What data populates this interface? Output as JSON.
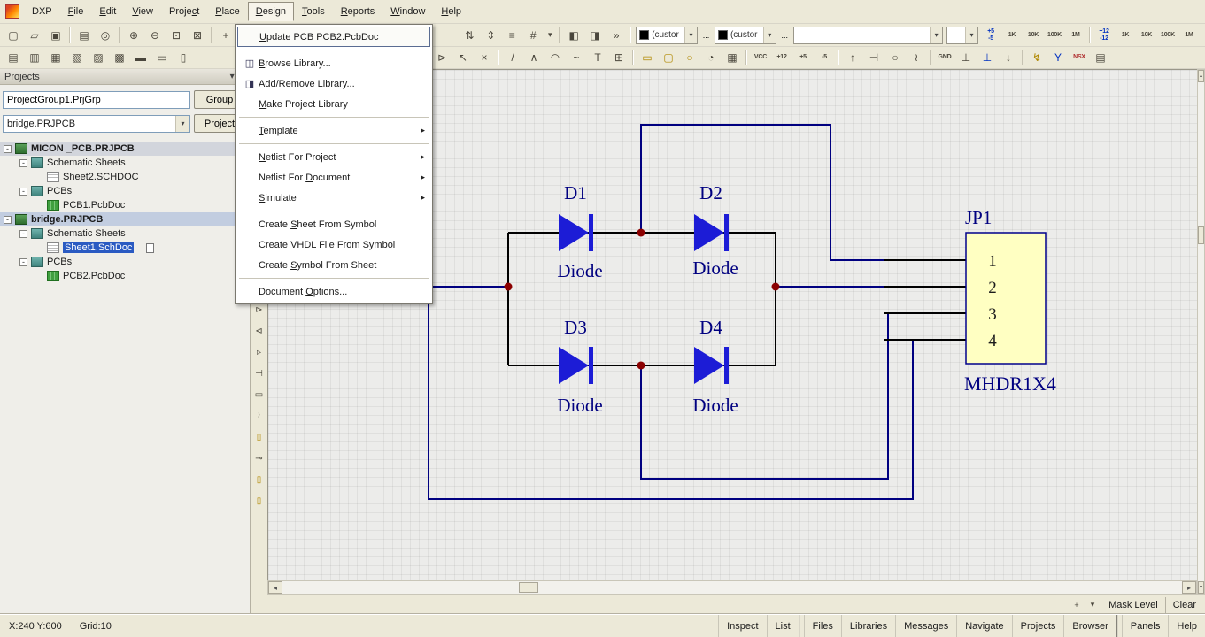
{
  "colors": {
    "chrome": "#ece9d8",
    "canvas-bg": "#ececea",
    "selection": "#2a5ac2",
    "wire": "#000080",
    "circuit": "#000000",
    "junction": "#8b0000",
    "diode": "#1c1cd6",
    "part-fill": "#ffffc2",
    "part-outline": "#00008b",
    "label": "#000080"
  },
  "menubar": {
    "items": [
      {
        "name": "menu-dxp",
        "label": "DXP",
        "hot": -1
      },
      {
        "name": "menu-file",
        "label": "File",
        "hot": 0
      },
      {
        "name": "menu-edit",
        "label": "Edit",
        "hot": 0
      },
      {
        "name": "menu-view",
        "label": "View",
        "hot": 0
      },
      {
        "name": "menu-project",
        "label": "Project",
        "hot": 5
      },
      {
        "name": "menu-place",
        "label": "Place",
        "hot": 0
      },
      {
        "name": "menu-design",
        "label": "Design",
        "hot": 0,
        "cls": "active"
      },
      {
        "name": "menu-tools",
        "label": "Tools",
        "hot": 0
      },
      {
        "name": "menu-reports",
        "label": "Reports",
        "hot": 0
      },
      {
        "name": "menu-window",
        "label": "Window",
        "hot": 0
      },
      {
        "name": "menu-help",
        "label": "Help",
        "hot": 0
      }
    ]
  },
  "design_menu": {
    "items": [
      {
        "name": "menu-update-pcb",
        "label": "Update PCB PCB2.PcbDoc",
        "hot": 0,
        "cls": "hover"
      },
      {
        "cls": "sep"
      },
      {
        "name": "menu-browse-library",
        "label": "Browse Library...",
        "hot": 0,
        "icon": "◫"
      },
      {
        "name": "menu-add-remove-library",
        "label": "Add/Remove Library...",
        "hot": 11,
        "icon": "◨"
      },
      {
        "name": "menu-make-project-library",
        "label": "Make Project Library",
        "hot": 0
      },
      {
        "cls": "sep"
      },
      {
        "name": "menu-template",
        "label": "Template",
        "hot": 0,
        "arrow": "▸"
      },
      {
        "cls": "sep"
      },
      {
        "name": "menu-netlist-project",
        "label": "Netlist For Project",
        "hot": 0,
        "arrow": "▸"
      },
      {
        "name": "menu-netlist-document",
        "label": "Netlist For Document",
        "hot": 12,
        "arrow": "▸"
      },
      {
        "name": "menu-simulate",
        "label": "Simulate",
        "hot": 0,
        "arrow": "▸"
      },
      {
        "cls": "sep"
      },
      {
        "name": "menu-create-sheet-from-symbol",
        "label": "Create Sheet From Symbol",
        "hot": 7
      },
      {
        "name": "menu-create-vhdl",
        "label": "Create VHDL File From Symbol",
        "hot": 7
      },
      {
        "name": "menu-create-symbol-from-sheet",
        "label": "Create Symbol From Sheet",
        "hot": 7
      },
      {
        "cls": "sep"
      },
      {
        "name": "menu-document-options",
        "label": "Document Options...",
        "hot": 9
      }
    ]
  },
  "toolbar1": {
    "left": [
      {
        "name": "new-document-button",
        "glyph": "▢"
      },
      {
        "name": "open-document-button",
        "glyph": "▱"
      },
      {
        "name": "save-button",
        "glyph": "▣"
      },
      {
        "cls": "sep"
      },
      {
        "name": "print-button",
        "glyph": "▤"
      },
      {
        "name": "print-preview-button",
        "glyph": "◎"
      },
      {
        "cls": "sep"
      },
      {
        "name": "zoom-in-button",
        "glyph": "⊕"
      },
      {
        "name": "zoom-out-button",
        "glyph": "⊖"
      },
      {
        "name": "zoom-area-button",
        "glyph": "⊡"
      },
      {
        "name": "zoom-selection-button",
        "glyph": "⊠"
      },
      {
        "cls": "sep"
      },
      {
        "name": "cross-probe-button",
        "glyph": "+"
      },
      {
        "name": "select-area-button",
        "glyph": "▫"
      }
    ],
    "mid": [
      {
        "name": "move-up-down-button",
        "glyph": "⇅"
      },
      {
        "name": "reorder-button",
        "glyph": "⇕"
      },
      {
        "name": "numbered-list-button",
        "glyph": "≡"
      },
      {
        "name": "grid-settings-button",
        "glyph": "#"
      },
      {
        "name": "grid-dropdown",
        "glyph": "▾",
        "cls": "narrow"
      },
      {
        "cls": "sep"
      },
      {
        "name": "browse-library-button",
        "glyph": "◧"
      },
      {
        "name": "add-library-button",
        "glyph": "◨"
      },
      {
        "name": "more-tools-chevron",
        "glyph": "»"
      },
      {
        "cls": "sep"
      }
    ],
    "color_combo_label": "(custor",
    "dots_label": "...",
    "long_combo_value": "",
    "small_combo_value": "",
    "right": [
      {
        "name": "vsource-5v-button",
        "glyph": "+5\n-5",
        "cls": "blue tiny"
      },
      {
        "name": "resistor-1k-button",
        "glyph": "1K",
        "cls": "tiny"
      },
      {
        "name": "resistor-10k-button",
        "glyph": "10K",
        "cls": "tiny"
      },
      {
        "name": "resistor-100k-button",
        "glyph": "100K",
        "cls": "tiny"
      },
      {
        "name": "resistor-1m-button",
        "glyph": "1M",
        "cls": "tiny"
      },
      {
        "cls": "sep"
      },
      {
        "name": "vsource-12v-button",
        "glyph": "+12\n-12",
        "cls": "blue tiny"
      },
      {
        "name": "resistor2-1k-button",
        "glyph": "1K",
        "cls": "tiny"
      },
      {
        "name": "resistor2-10k-button",
        "glyph": "10K",
        "cls": "tiny"
      },
      {
        "name": "resistor2-100k-button",
        "glyph": "100K",
        "cls": "tiny"
      },
      {
        "name": "resistor2-1m-button",
        "glyph": "1M",
        "cls": "tiny"
      }
    ]
  },
  "toolbar2": {
    "left": [
      {
        "name": "sheet-symbol-button",
        "glyph": "▤"
      },
      {
        "name": "sheet-entry-button",
        "glyph": "▥"
      },
      {
        "name": "place-part-button",
        "glyph": "▦"
      },
      {
        "name": "copy-button",
        "glyph": "▧"
      },
      {
        "name": "paste-button",
        "glyph": "▨"
      },
      {
        "name": "paste-array-button",
        "glyph": "▩"
      },
      {
        "name": "duplicate-button",
        "glyph": "▬"
      },
      {
        "name": "align-button",
        "glyph": "▭"
      },
      {
        "name": "group-objects-button",
        "glyph": "▯"
      }
    ],
    "mid": [
      {
        "name": "place-wire-button",
        "glyph": "⊳"
      },
      {
        "name": "drag-select-button",
        "glyph": "↖"
      },
      {
        "name": "delete-button",
        "glyph": "×"
      },
      {
        "cls": "sep"
      },
      {
        "name": "place-line-button",
        "glyph": "/"
      },
      {
        "name": "place-polyline-button",
        "glyph": "∧"
      },
      {
        "name": "place-arc-button",
        "glyph": "◠"
      },
      {
        "name": "place-sine-button",
        "glyph": "~"
      },
      {
        "name": "place-text-button",
        "glyph": "T"
      },
      {
        "name": "place-table-button",
        "glyph": "⊞"
      },
      {
        "cls": "sep"
      },
      {
        "name": "place-rectangle-button",
        "glyph": "▭",
        "cls": "gold"
      },
      {
        "name": "place-round-rect-button",
        "glyph": "▢",
        "cls": "gold"
      },
      {
        "name": "place-ellipse-button",
        "glyph": "○",
        "cls": "gold"
      },
      {
        "name": "place-pie-button",
        "glyph": "◔"
      },
      {
        "name": "place-array-button",
        "glyph": "▦"
      },
      {
        "cls": "sep"
      },
      {
        "name": "power-vcc-button",
        "glyph": "VCC",
        "cls": "tiny"
      },
      {
        "name": "power-plus12-button",
        "glyph": "+12",
        "cls": "tiny"
      },
      {
        "name": "power-plus5-button",
        "glyph": "+5",
        "cls": "tiny"
      },
      {
        "name": "power-minus5-button",
        "glyph": "-5",
        "cls": "tiny"
      },
      {
        "cls": "sep"
      },
      {
        "name": "power-arrow-button",
        "glyph": "↑"
      },
      {
        "name": "power-bar-button",
        "glyph": "⊣"
      },
      {
        "name": "power-circle-button",
        "glyph": "○"
      },
      {
        "name": "power-wave-button",
        "glyph": "≀"
      },
      {
        "cls": "sep"
      },
      {
        "name": "power-gnd-button",
        "glyph": "GND",
        "cls": "tiny"
      },
      {
        "name": "ground-button",
        "glyph": "⊥"
      },
      {
        "name": "earth-ground-button",
        "glyph": "⊥",
        "cls": "blue"
      },
      {
        "name": "signal-ground-button",
        "glyph": "↓"
      },
      {
        "cls": "sep"
      },
      {
        "name": "probe-button",
        "glyph": "↯",
        "cls": "gold"
      },
      {
        "name": "wye-button",
        "glyph": "Y",
        "cls": "blue"
      },
      {
        "name": "nsx-button",
        "glyph": "NSX",
        "cls": "tiny red"
      },
      {
        "name": "sheet-button",
        "glyph": "▤"
      }
    ]
  },
  "utilities": [
    {
      "name": "diode-part-tool",
      "glyph": "⊳"
    },
    {
      "name": "diode-alt-part-tool",
      "glyph": "⊲"
    },
    {
      "name": "arrow-tool",
      "glyph": "▹"
    },
    {
      "name": "pin-tool",
      "glyph": "⊣"
    },
    {
      "name": "resistor-tool",
      "glyph": "▭"
    },
    {
      "name": "wave-tool",
      "glyph": "≀"
    },
    {
      "name": "doc-part-tool",
      "glyph": "▯",
      "cls": "gold"
    },
    {
      "name": "probe-part-tool",
      "glyph": "⊸"
    },
    {
      "name": "capacitor-tool",
      "glyph": "▯",
      "cls": "gold"
    },
    {
      "name": "cylinder-part-tool",
      "glyph": "▯",
      "cls": "gold"
    }
  ],
  "projects_panel": {
    "title": "Projects",
    "menu_icon": "▾",
    "pin_icon": "↧",
    "group_input": "ProjectGroup1.PrjGrp",
    "group_button": "Group",
    "project_select": "bridge.PRJPCB",
    "project_button": "Project",
    "tree": [
      {
        "name": "tree-item-micon-project",
        "label": "MICON _PCB.PRJPCB",
        "expand": "-",
        "icon": "prj",
        "cls": "lvl0 project hl-gray"
      },
      {
        "name": "tree-item-schematic-sheets-1",
        "label": "Schematic Sheets",
        "expand": "-",
        "icon": "fold",
        "cls": "lvl1"
      },
      {
        "name": "tree-item-sheet2",
        "label": "Sheet2.SCHDOC",
        "icon": "sch",
        "cls": "lvl2"
      },
      {
        "name": "tree-item-pcbs-1",
        "label": "PCBs",
        "expand": "-",
        "icon": "fold",
        "cls": "lvl1"
      },
      {
        "name": "tree-item-pcb1",
        "label": "PCB1.PcbDoc",
        "icon": "pcb",
        "cls": "lvl2"
      },
      {
        "name": "tree-item-bridge-project",
        "label": "bridge.PRJPCB",
        "expand": "-",
        "icon": "prj",
        "cls": "lvl0 project hl-blue"
      },
      {
        "name": "tree-item-schematic-sheets-2",
        "label": "Schematic Sheets",
        "expand": "-",
        "icon": "fold",
        "cls": "lvl1"
      },
      {
        "name": "tree-item-sheet1",
        "label": "Sheet1.SchDoc",
        "icon": "sch",
        "cls": "lvl2 selected",
        "badge": "doc"
      },
      {
        "name": "tree-item-pcbs-2",
        "label": "PCBs",
        "expand": "-",
        "icon": "fold",
        "cls": "lvl1"
      },
      {
        "name": "tree-item-pcb2",
        "label": "PCB2.PcbDoc",
        "icon": "pcb",
        "cls": "lvl2"
      }
    ]
  },
  "schematic": {
    "diodes": [
      {
        "ref": "D1",
        "value": "Diode"
      },
      {
        "ref": "D2",
        "value": "Diode"
      },
      {
        "ref": "D3",
        "value": "Diode"
      },
      {
        "ref": "D4",
        "value": "Diode"
      }
    ],
    "connector": {
      "ref": "JP1",
      "part": "MHDR1X4",
      "pins": [
        "1",
        "2",
        "3",
        "4"
      ]
    }
  },
  "mask_strip": {
    "icons": [
      {
        "name": "mask-filter-icon",
        "glyph": "+"
      },
      {
        "name": "mask-dropdown-icon",
        "glyph": "▾"
      }
    ],
    "mask_label": "Mask Level",
    "clear_label": "Clear"
  },
  "statusbar": {
    "coords": "X:240 Y:600",
    "grid": "Grid:10",
    "panels": [
      {
        "name": "panel-tab-inspect",
        "label": "Inspect"
      },
      {
        "name": "panel-tab-list",
        "label": "List",
        "cls": "gend"
      },
      {
        "name": "panel-tab-files",
        "label": "Files"
      },
      {
        "name": "panel-tab-libraries",
        "label": "Libraries"
      },
      {
        "name": "panel-tab-messages",
        "label": "Messages"
      },
      {
        "name": "panel-tab-navigate",
        "label": "Navigate"
      },
      {
        "name": "panel-tab-projects",
        "label": "Projects"
      },
      {
        "name": "panel-tab-browser",
        "label": "Browser",
        "cls": "gend"
      },
      {
        "name": "panel-tab-panels",
        "label": "Panels"
      },
      {
        "name": "panel-tab-help",
        "label": "Help"
      }
    ]
  },
  "scroll": {
    "h_left": "◂",
    "h_right": "▸",
    "v_up": "▴",
    "v_down": "▾"
  }
}
